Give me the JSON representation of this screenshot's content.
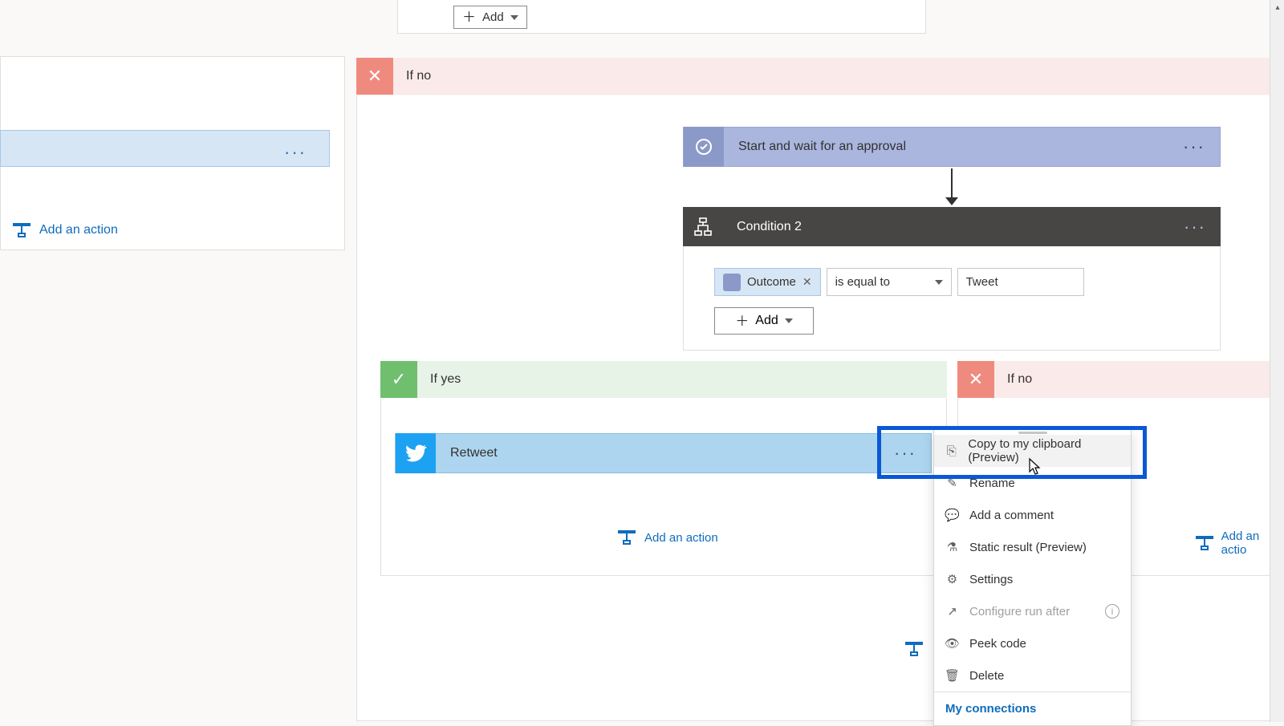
{
  "topAdd": {
    "label": "Add"
  },
  "leftPanel": {
    "addAction": "Add an action"
  },
  "ifNo": {
    "label": "If no"
  },
  "approval": {
    "title": "Start and wait for an approval"
  },
  "condition": {
    "title": "Condition 2",
    "pill": "Outcome",
    "operator": "is equal to",
    "value": "Tweet",
    "addLabel": "Add"
  },
  "branchYes": {
    "label": "If yes",
    "addAction": "Add an action"
  },
  "branchNo2": {
    "label": "If no",
    "addAction": "Add an actio"
  },
  "retweet": {
    "title": "Retweet"
  },
  "ctxMenu": {
    "copy": "Copy to my clipboard (Preview)",
    "rename": "Rename",
    "comment": "Add a comment",
    "static": "Static result (Preview)",
    "settings": "Settings",
    "configure": "Configure run after",
    "peek": "Peek code",
    "delete": "Delete",
    "connections": "My connections"
  }
}
